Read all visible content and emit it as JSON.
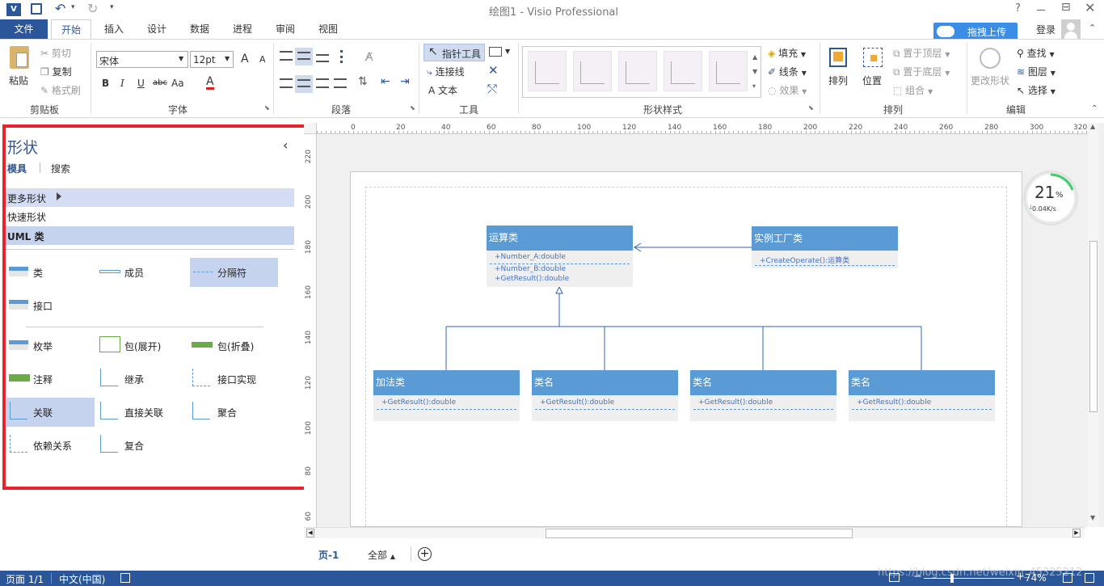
{
  "app": {
    "logo": "V",
    "title": "绘图1 - Visio Professional",
    "window_controls": {
      "help": "?",
      "restore": "⊟"
    }
  },
  "tabs": {
    "file": "文件",
    "items": [
      "开始",
      "插入",
      "设计",
      "数据",
      "进程",
      "审阅",
      "视图"
    ],
    "upload_button": "拖拽上传",
    "login": "登录"
  },
  "ribbon": {
    "clipboard": {
      "paste": "粘贴",
      "cut": "剪切",
      "copy": "复制",
      "format_painter": "格式刷",
      "label": "剪贴板"
    },
    "font": {
      "name": "宋体",
      "size": "12pt",
      "grow": "A",
      "shrink": "A",
      "bold": "B",
      "italic": "I",
      "underline": "U",
      "strike": "abc",
      "case": "Aa",
      "color": "A",
      "label": "字体"
    },
    "paragraph": {
      "label": "段落"
    },
    "tools": {
      "pointer": "指针工具",
      "connector": "连接线",
      "text": "文本",
      "label": "工具"
    },
    "shape_styles": {
      "fill": "填充",
      "line": "线条",
      "effects": "效果",
      "label": "形状样式"
    },
    "arrange": {
      "arrange": "排列",
      "position": "位置",
      "bring_front": "置于顶层",
      "send_back": "置于底层",
      "group": "组合",
      "label": "排列"
    },
    "editing": {
      "change_shape": "更改形状",
      "find": "查找",
      "layers": "图层",
      "select": "选择",
      "label": "编辑"
    }
  },
  "shapes_panel": {
    "title": "形状",
    "collapse": "‹",
    "tab_stencils": "模具",
    "tab_search": "搜索",
    "more_shapes": "更多形状",
    "quick_shapes": "快速形状",
    "stencil": "UML 类",
    "items": [
      "类",
      "成员",
      "分隔符",
      "接口",
      "枚举",
      "包(展开)",
      "包(折叠)",
      "注释",
      "继承",
      "接口实现",
      "关联",
      "直接关联",
      "聚合",
      "依赖关系",
      "复合"
    ]
  },
  "ruler": {
    "top": [
      "0",
      "20",
      "40",
      "60",
      "80",
      "100",
      "120",
      "140",
      "160",
      "180",
      "200",
      "220",
      "240",
      "260",
      "280",
      "300",
      "320"
    ],
    "left": [
      "220",
      "200",
      "180",
      "160",
      "140",
      "120",
      "100",
      "80",
      "60"
    ]
  },
  "diagram": {
    "operation": {
      "title": "运算类",
      "members": [
        "+Number_A:double",
        "+Number_B:double",
        "+GetResult():double"
      ]
    },
    "factory": {
      "title": "实例工厂类",
      "members": [
        "+CreateOperate():运算类"
      ]
    },
    "children": [
      {
        "title": "加法类",
        "member": "+GetResult():double"
      },
      {
        "title": "类名",
        "member": "+GetResult():double"
      },
      {
        "title": "类名",
        "member": "+GetResult():double"
      },
      {
        "title": "类名",
        "member": "+GetResult():double"
      }
    ]
  },
  "speed_widget": {
    "percent": "21",
    "percent_unit": "%",
    "rate": "0.04K/s"
  },
  "page_tabs": {
    "page1": "页-1",
    "all": "全部"
  },
  "status": {
    "page": "页面 1/1",
    "language": "中文(中国)",
    "zoom": "74%",
    "watermark": "https://blog.csdn.net/weixin_45325212"
  },
  "colors": {
    "accent": "#2b579a",
    "uml_blue": "#5b9bd5",
    "highlight_red": "#e8222b"
  }
}
